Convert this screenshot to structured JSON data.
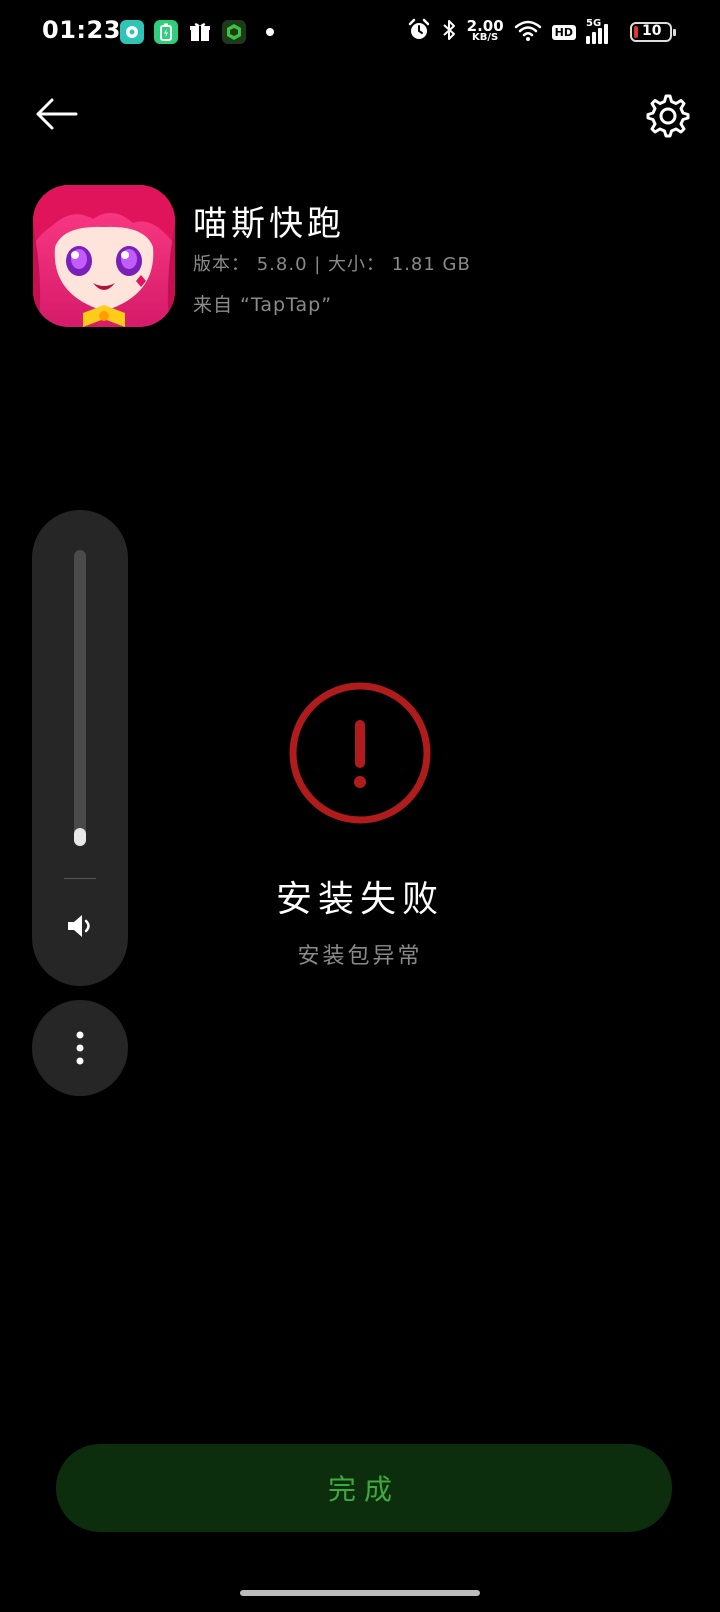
{
  "status_bar": {
    "time": "01:23",
    "net_speed_value": "2.00",
    "net_speed_unit": "KB/S",
    "hd_label": "HD",
    "network_type": "5G",
    "battery_level": "10",
    "battery_color": "#e33333"
  },
  "header": {
    "back_icon": "arrow-left-icon",
    "settings_icon": "gear-icon"
  },
  "app": {
    "name": "喵斯快跑",
    "meta": "版本： 5.8.0 | 大小： 1.81 GB",
    "source": "来自 “TapTap”"
  },
  "volume": {
    "level": 0.06
  },
  "result": {
    "title": "安装失败",
    "subtitle": "安装包异常",
    "error_color": "#b01c1c"
  },
  "actions": {
    "done_label": "完成"
  }
}
